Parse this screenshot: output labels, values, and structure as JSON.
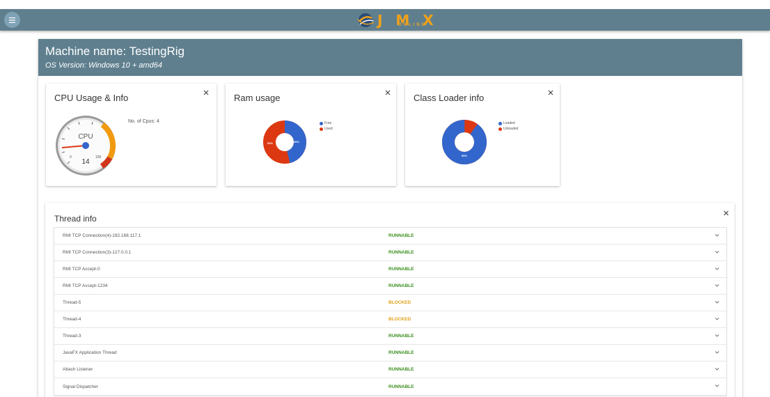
{
  "app": {
    "logo_letters": "J M X",
    "logo_sub": "ONLINE"
  },
  "machine": {
    "name": "Machine name: TestingRig",
    "os": "OS Version: Windows 10 + amd64"
  },
  "cpu": {
    "title": "CPU Usage & Info",
    "cpus_label": "No. of Cpus: 4",
    "gauge_label": "CPU",
    "gauge_value": "14",
    "gauge_min": "0",
    "gauge_max": "100"
  },
  "ram": {
    "title": "Ram usage",
    "legend": [
      "Free",
      "Used"
    ],
    "free_pct": "46%",
    "used_pct": "54%",
    "colors": {
      "free": "#3366cc",
      "used": "#dc3912"
    }
  },
  "classloader": {
    "title": "Class Loader info",
    "legend": [
      "Loaded",
      "Unloaded"
    ],
    "loaded_pct": "90%",
    "colors": {
      "loaded": "#3366cc",
      "unloaded": "#dc3912"
    }
  },
  "threads": {
    "title": "Thread info",
    "rows": [
      {
        "name": "RMI TCP Connection(4)-192.168.117.1",
        "state": "RUNNABLE"
      },
      {
        "name": "RMI TCP Connection(3)-127.0.0.1",
        "state": "RUNNABLE"
      },
      {
        "name": "RMI TCP Accept-0",
        "state": "RUNNABLE"
      },
      {
        "name": "RMI TCP Accept-1234",
        "state": "RUNNABLE"
      },
      {
        "name": "Thread-5",
        "state": "BLOCKED"
      },
      {
        "name": "Thread-4",
        "state": "BLOCKED"
      },
      {
        "name": "Thread-3",
        "state": "RUNNABLE"
      },
      {
        "name": "JavaFX Application Thread",
        "state": "RUNNABLE"
      },
      {
        "name": "Attach Listener",
        "state": "RUNNABLE"
      },
      {
        "name": "Signal Dispatcher",
        "state": "RUNNABLE"
      }
    ]
  },
  "colors": {
    "header": "#5f7f8e",
    "runnable": "#3a8f1c",
    "blocked": "#e0a21a",
    "accent": "#f0a21a"
  },
  "icons": [
    "menu-icon",
    "close-icon",
    "chevron-down-icon",
    "globe-logo-icon"
  ]
}
